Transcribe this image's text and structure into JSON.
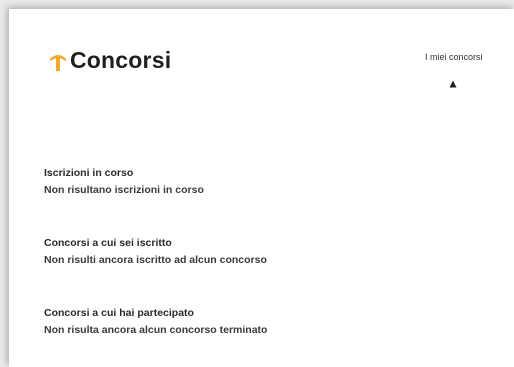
{
  "header": {
    "logo_icon": "arrow-up-icon",
    "title": "Concorsi",
    "accent_color": "#f5a623",
    "nav_link": "I miei concorsi",
    "nav_caret_icon": "caret-up-icon"
  },
  "sections": [
    {
      "title": "Iscrizioni in corso",
      "empty_text": "Non risultano iscrizioni in corso"
    },
    {
      "title": "Concorsi a cui sei iscritto",
      "empty_text": "Non risulti ancora iscritto ad alcun concorso"
    },
    {
      "title": "Concorsi a cui hai partecipato",
      "empty_text": "Non risulta ancora alcun concorso terminato"
    }
  ]
}
